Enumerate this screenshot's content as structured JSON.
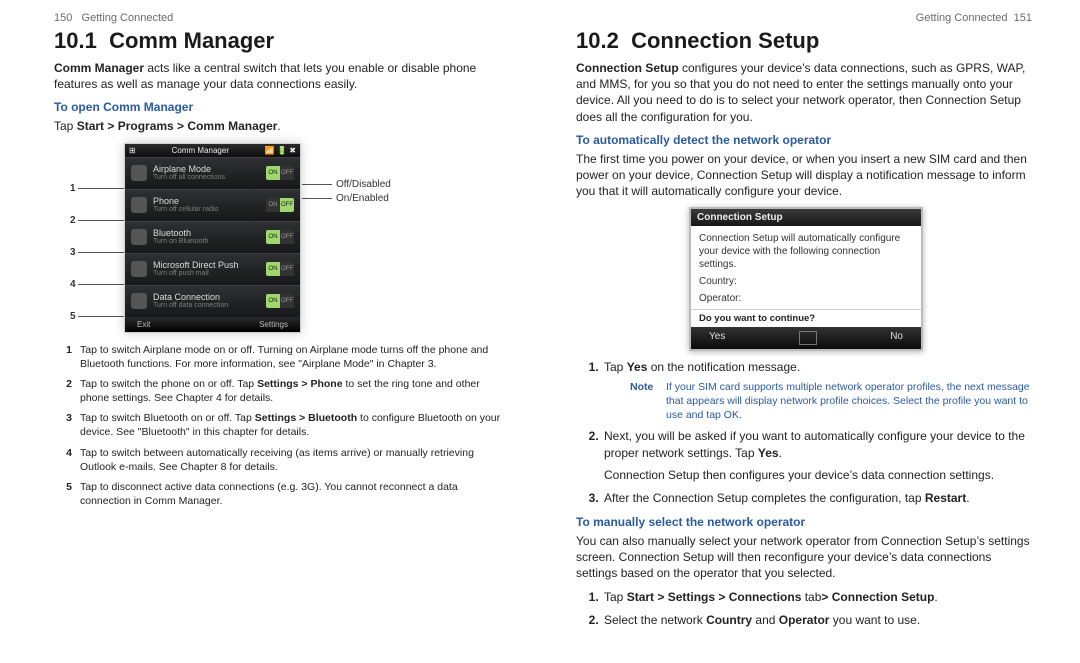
{
  "left": {
    "running_head_num": "150",
    "running_head_title": "Getting Connected",
    "section_number": "10.1",
    "section_title": "Comm Manager",
    "intro_bold": "Comm Manager",
    "intro_rest": " acts like a central switch that lets you enable or disable phone features as well as manage your data connections easily.",
    "sub_open": "To open Comm Manager",
    "tap_line_pre": "Tap  ",
    "tap_line_path": "Start > Programs > Comm Manager",
    "tap_line_suffix": ".",
    "screen": {
      "status_left": "⊞",
      "status_title": "Comm Manager",
      "status_icons": "📶 🔋 ✖",
      "rows": [
        {
          "title": "Airplane Mode",
          "sub": "Turn off all connections",
          "state_left": "ON",
          "state_right": "OFF",
          "on_left": true
        },
        {
          "title": "Phone",
          "sub": "Turn off cellular radio",
          "state_left": "ON",
          "state_right": "OFF",
          "on_left": false
        },
        {
          "title": "Bluetooth",
          "sub": "Turn on Bluetooth",
          "state_left": "ON",
          "state_right": "OFF",
          "on_left": true
        },
        {
          "title": "Microsoft Direct Push",
          "sub": "Turn off push mail",
          "state_left": "ON",
          "state_right": "OFF",
          "on_left": true
        },
        {
          "title": "Data Connection",
          "sub": "Turn off data connection",
          "state_left": "ON",
          "state_right": "OFF",
          "on_left": true
        }
      ],
      "soft_left": "Exit",
      "soft_right": "Settings"
    },
    "labels": {
      "off": "Off/Disabled",
      "on": "On/Enabled"
    },
    "list": [
      "Tap to switch Airplane mode on or off. Turning on Airplane mode turns off the phone and Bluetooth functions. For more information, see \"Airplane Mode\" in Chapter 3.",
      "Tap to switch the phone on or off. Tap Settings > Phone to set the ring tone and other phone settings. See Chapter 4 for details.",
      "Tap to switch Bluetooth on or off. Tap Settings > Bluetooth to configure Bluetooth on your device. See \"Bluetooth\" in this chapter for details.",
      "Tap to switch between automatically receiving (as items arrive) or manually retrieving Outlook e-mails. See Chapter 8 for details.",
      "Tap to disconnect active data connections (e.g. 3G). You cannot reconnect a data connection in Comm Manager."
    ]
  },
  "right": {
    "running_head_title": "Getting Connected",
    "running_head_num": "151",
    "section_number": "10.2",
    "section_title": "Connection Setup",
    "intro_bold": "Connection Setup",
    "intro_rest": " configures your device’s data connections, such as GPRS, WAP, and MMS, for you so that you do not need to enter the settings manually onto your device. All you need to do is to select your network operator, then Connection Setup does all the configuration for you.",
    "sub_auto": "To automatically detect the network operator",
    "auto_para": "The first time you power on your device, or when you insert a new SIM card and then power on your device, Connection Setup will display a notification message to inform you that it will automatically configure your device.",
    "dialog": {
      "title": "Connection Setup",
      "body1": "Connection Setup will automatically configure your device with the following connection settings.",
      "country_label": "Country:",
      "operator_label": "Operator:",
      "question": "Do you want to continue?",
      "yes": "Yes",
      "no": "No"
    },
    "ol1_pre": "Tap ",
    "ol1_bold": "Yes",
    "ol1_post": " on the notification message.",
    "note_label": "Note",
    "note_text": "If your SIM card supports multiple network operator profiles, the next message that appears will display network profile choices. Select the profile you want to use and tap OK.",
    "ol2_pre": "Next, you will be asked if you want to automatically configure your device to the proper network settings. Tap ",
    "ol2_bold": "Yes",
    "ol2_post": ".",
    "ol2_after": "Connection Setup then configures your device’s data connection settings.",
    "ol3_pre": "After the Connection Setup completes the configuration, tap ",
    "ol3_bold": "Restart",
    "ol3_post": ".",
    "sub_manual": "To manually select the network operator",
    "manual_para": "You can also manually select your network operator from Connection Setup’s settings screen. Connection Setup will then reconfigure your device’s data connections settings based on the operator that you selected.",
    "m1_pre": "Tap ",
    "m1_bold": "Start > Settings > Connections ",
    "m1_mid": "tab",
    "m1_bold2": "> Connection Setup",
    "m1_post": ".",
    "m2_pre": "Select the network ",
    "m2_b1": "Country",
    "m2_mid": " and ",
    "m2_b2": "Operator",
    "m2_post": " you want to use."
  }
}
